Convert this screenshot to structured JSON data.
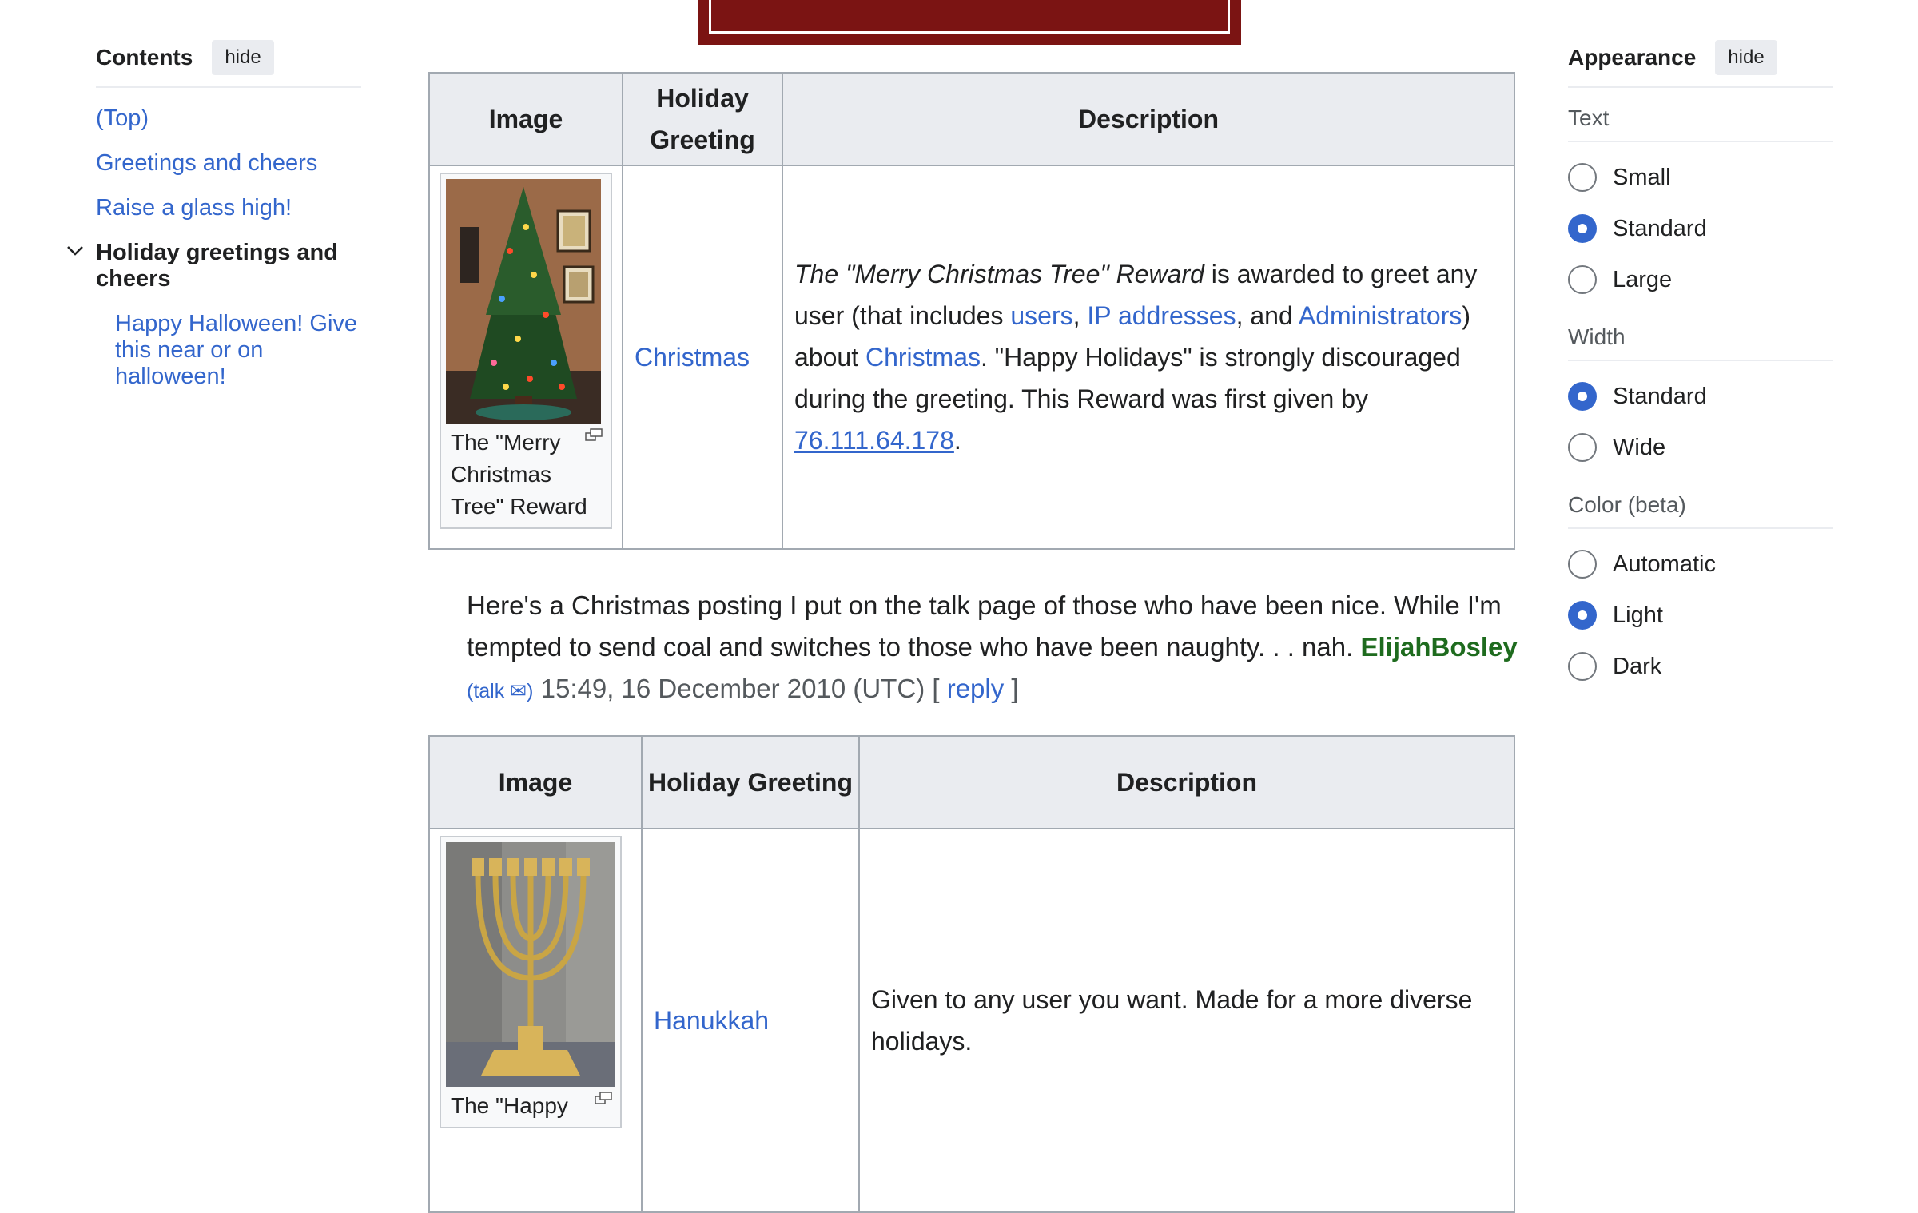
{
  "toc": {
    "title": "Contents",
    "hide_label": "hide",
    "items": [
      {
        "label": "(Top)"
      },
      {
        "label": "Greetings and cheers"
      },
      {
        "label": "Raise a glass high!"
      },
      {
        "label": "Holiday greetings and cheers"
      },
      {
        "label": "Happy Halloween! Give this near or on halloween!"
      }
    ]
  },
  "appearance": {
    "title": "Appearance",
    "hide_label": "hide",
    "text_label": "Text",
    "text_options": [
      "Small",
      "Standard",
      "Large"
    ],
    "text_selected": "Standard",
    "width_label": "Width",
    "width_options": [
      "Standard",
      "Wide"
    ],
    "width_selected": "Standard",
    "color_label": "Color (beta)",
    "color_options": [
      "Automatic",
      "Light",
      "Dark"
    ],
    "color_selected": "Light"
  },
  "tables": [
    {
      "headers": [
        "Image",
        "Holiday Greeting",
        "Description"
      ],
      "caption": "The \"Merry Christmas Tree\" Reward",
      "greeting": "Christmas",
      "desc": {
        "italic": "The \"Merry Christmas Tree\" Reward",
        "t1": " is awarded to greet any user (that includes ",
        "l1": "users",
        "t2": ", ",
        "l2": "IP addresses",
        "t3": ", and ",
        "l3": "Administrators",
        "t4": ") about ",
        "l4": "Christmas",
        "t5": ". \"Happy Holidays\" is strongly discouraged during the greeting. This Reward was first given by ",
        "l5": "76.111.64.178",
        "t6": "."
      }
    },
    {
      "headers": [
        "Image",
        "Holiday Greeting",
        "Description"
      ],
      "caption": "The \"Happy",
      "greeting": "Hanukkah",
      "desc_text": "Given to any user you want. Made for a more diverse holidays."
    }
  ],
  "discussion": {
    "text": "Here's a Christmas posting I put on the talk page of those who have been nice. While I'm tempted to send coal and switches to those who have been naughty. . . nah. ",
    "signature": "ElijahBosley",
    "talk": "(talk ✉)",
    "timestamp": " 15:49, 16 December 2010 (UTC) ",
    "reply_open": "[",
    "reply": "reply",
    "reply_close": "]"
  },
  "colors": {
    "link": "#3366cc",
    "signature": "#1e6b1e",
    "radio_checked": "#3366cc",
    "banner": "#7b1413"
  }
}
